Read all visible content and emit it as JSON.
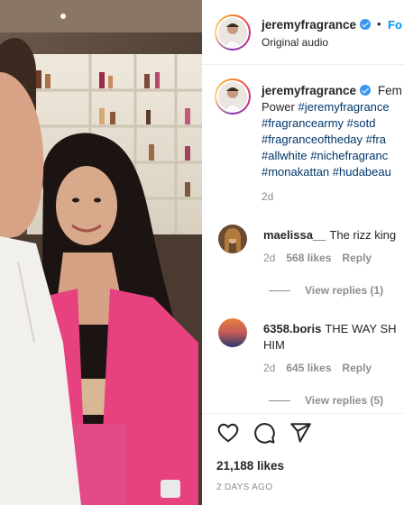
{
  "header": {
    "username": "jeremyfragrance",
    "separator": "•",
    "follow_label": "Fo",
    "audio_label": "Original audio"
  },
  "caption": {
    "username": "jeremyfragrance",
    "line1_text": "Fem",
    "line2_text": "Power",
    "line2_tag": "#jeremyfragrance",
    "line3": "#fragrancearmy #sotd",
    "line4": "#fragranceoftheday #fra",
    "line5": "#allwhite #nichefragranc",
    "line6": "#monakattan #hudabeau",
    "time": "2d"
  },
  "comments": [
    {
      "username": "maelissa__",
      "text": "The rizz king",
      "line2": "",
      "time": "2d",
      "likes": "568 likes",
      "reply": "Reply",
      "view_replies": "View replies (1)"
    },
    {
      "username": "6358.boris",
      "text": "THE WAY SH",
      "line2": "HIM",
      "time": "2d",
      "likes": "645 likes",
      "reply": "Reply",
      "view_replies": "View replies (5)"
    }
  ],
  "actions": {
    "likes_count": "21,188 likes",
    "posted_ago": "2 DAYS AGO"
  },
  "icons": [
    "heart-icon",
    "comment-icon",
    "share-icon",
    "verified-badge-icon"
  ],
  "colors": {
    "link_blue": "#0095f6",
    "hashtag": "#00376b",
    "muted": "#8e8e8e",
    "verified": "#3897f0",
    "dress_pink": "#e8417f"
  }
}
